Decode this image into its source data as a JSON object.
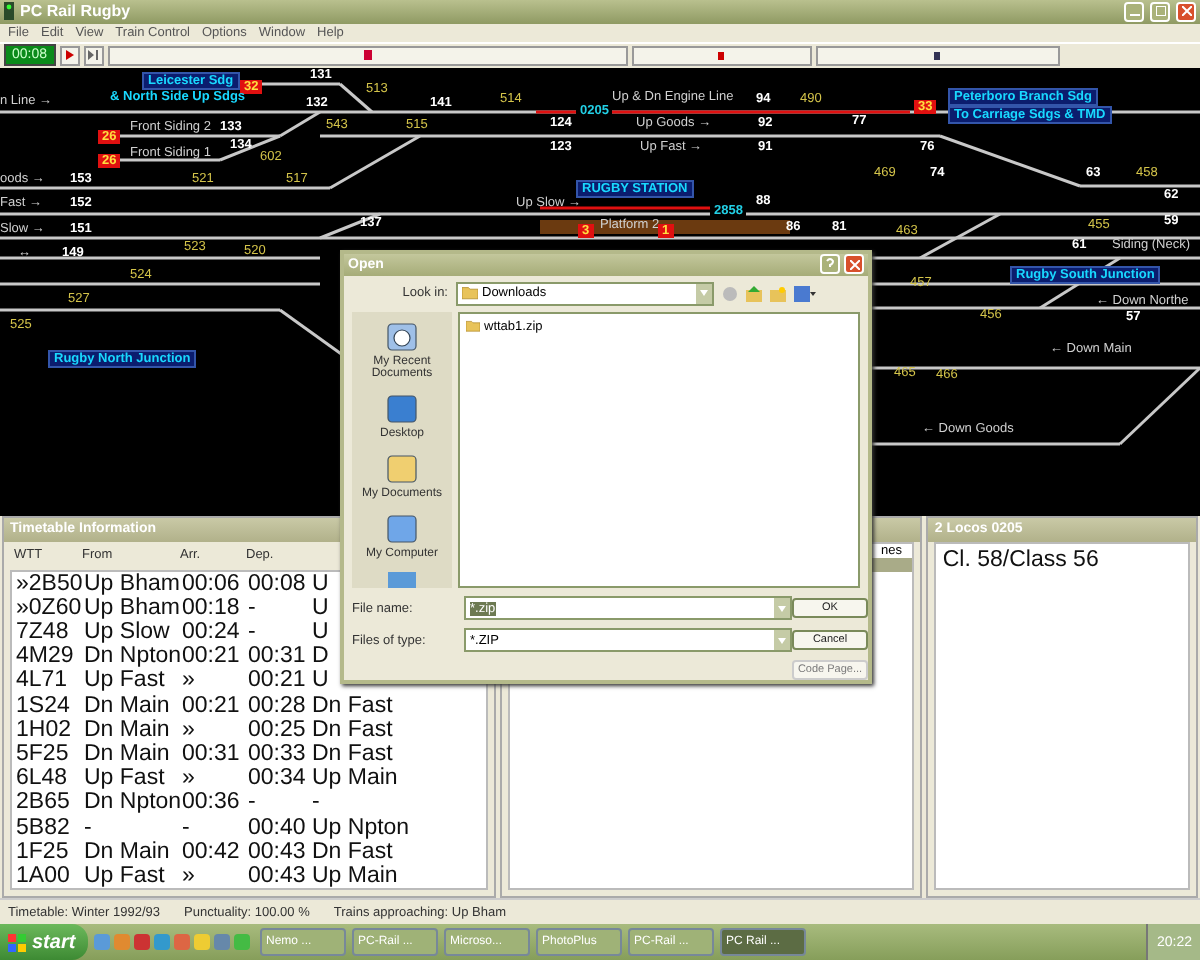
{
  "window": {
    "title": "PC Rail Rugby"
  },
  "menu": [
    "File",
    "Edit",
    "View",
    "Train Control",
    "Options",
    "Window",
    "Help"
  ],
  "toolbar": {
    "clock": "00:08"
  },
  "diagram": {
    "labels": [
      {
        "kind": "area",
        "text": "Leicester Sdg"
      },
      {
        "kind": "berth",
        "text": "32"
      },
      {
        "kind": "signal",
        "text": "131"
      },
      {
        "kind": "point",
        "text": "513"
      },
      {
        "kind": "line",
        "text": "n Line →"
      },
      {
        "kind": "location",
        "text": "& North Side Up Sdgs"
      },
      {
        "kind": "signal",
        "text": "132"
      },
      {
        "kind": "signal",
        "text": "141"
      },
      {
        "kind": "point",
        "text": "514"
      },
      {
        "kind": "line",
        "text": "Up & Dn Engine Line"
      },
      {
        "kind": "signal",
        "text": "94"
      },
      {
        "kind": "point",
        "text": "490"
      },
      {
        "kind": "area",
        "text": "Peterboro Branch Sdg"
      },
      {
        "kind": "train",
        "text": "0205"
      },
      {
        "kind": "berth",
        "text": "33"
      },
      {
        "kind": "area",
        "text": "To Carriage Sdgs & TMD"
      },
      {
        "kind": "line",
        "text": "Front Siding 2"
      },
      {
        "kind": "signal",
        "text": "133"
      },
      {
        "kind": "point",
        "text": "543"
      },
      {
        "kind": "point",
        "text": "515"
      },
      {
        "kind": "signal",
        "text": "124"
      },
      {
        "kind": "line",
        "text": "Up Goods →"
      },
      {
        "kind": "signal",
        "text": "92"
      },
      {
        "kind": "signal",
        "text": "77"
      },
      {
        "kind": "berth",
        "text": "26"
      },
      {
        "kind": "signal",
        "text": "134"
      },
      {
        "kind": "signal",
        "text": "123"
      },
      {
        "kind": "line",
        "text": "Up Fast →"
      },
      {
        "kind": "signal",
        "text": "91"
      },
      {
        "kind": "signal",
        "text": "76"
      },
      {
        "kind": "berth",
        "text": "26"
      },
      {
        "kind": "line",
        "text": "Front Siding 1"
      },
      {
        "kind": "point",
        "text": "602"
      },
      {
        "kind": "line",
        "text": "oods →"
      },
      {
        "kind": "signal",
        "text": "153"
      },
      {
        "kind": "point",
        "text": "521"
      },
      {
        "kind": "point",
        "text": "517"
      },
      {
        "kind": "point",
        "text": "469"
      },
      {
        "kind": "signal",
        "text": "74"
      },
      {
        "kind": "signal",
        "text": "63"
      },
      {
        "kind": "point",
        "text": "458"
      },
      {
        "kind": "area",
        "text": "RUGBY STATION"
      },
      {
        "kind": "signal",
        "text": "62"
      },
      {
        "kind": "line",
        "text": "Fast →"
      },
      {
        "kind": "signal",
        "text": "152"
      },
      {
        "kind": "line",
        "text": "Up Slow →"
      },
      {
        "kind": "signal",
        "text": "88"
      },
      {
        "kind": "train",
        "text": "2858"
      },
      {
        "kind": "line",
        "text": "Slow →"
      },
      {
        "kind": "signal",
        "text": "151"
      },
      {
        "kind": "signal",
        "text": "137"
      },
      {
        "kind": "berth",
        "text": "3"
      },
      {
        "kind": "line",
        "text": "Platform 2"
      },
      {
        "kind": "berth",
        "text": "1"
      },
      {
        "kind": "signal",
        "text": "86"
      },
      {
        "kind": "signal",
        "text": "81"
      },
      {
        "kind": "point",
        "text": "463"
      },
      {
        "kind": "point",
        "text": "455"
      },
      {
        "kind": "signal",
        "text": "59"
      },
      {
        "kind": "line",
        "text": "↔"
      },
      {
        "kind": "signal",
        "text": "149"
      },
      {
        "kind": "point",
        "text": "523"
      },
      {
        "kind": "point",
        "text": "520"
      },
      {
        "kind": "signal",
        "text": "61"
      },
      {
        "kind": "line",
        "text": "Siding (Neck)"
      },
      {
        "kind": "point",
        "text": "524"
      },
      {
        "kind": "point",
        "text": "457"
      },
      {
        "kind": "area",
        "text": "Rugby South Junction"
      },
      {
        "kind": "point",
        "text": "527"
      },
      {
        "kind": "line",
        "text": "← Down Northe"
      },
      {
        "kind": "point",
        "text": "525"
      },
      {
        "kind": "point",
        "text": "456"
      },
      {
        "kind": "signal",
        "text": "57"
      },
      {
        "kind": "area",
        "text": "Rugby North Junction"
      },
      {
        "kind": "line",
        "text": "← Down Main"
      },
      {
        "kind": "point",
        "text": "465"
      },
      {
        "kind": "point",
        "text": "466"
      },
      {
        "kind": "line",
        "text": "← Down Goods"
      }
    ]
  },
  "timetable": {
    "title": "Timetable Information",
    "columns": [
      "WTT",
      "From",
      "Arr.",
      "Dep."
    ],
    "rows": [
      [
        "»2B50",
        "Up Bham",
        "00:06",
        "00:08",
        "U"
      ],
      [
        "»0Z60",
        "Up Bham",
        "00:18",
        "-",
        "U"
      ],
      [
        "7Z48",
        "Up Slow",
        "00:24",
        "-",
        "U"
      ],
      [
        "4M29",
        "Dn Npton",
        "00:21",
        "00:31",
        "D"
      ],
      [
        "4L71",
        "Up Fast",
        "»",
        "00:21",
        "U"
      ],
      [
        "1S24",
        "Dn Main",
        "00:21",
        "00:28",
        "Dn Fast"
      ],
      [
        "1H02",
        "Dn Main",
        "»",
        "00:25",
        "Dn Fast"
      ],
      [
        "5F25",
        "Dn Main",
        "00:31",
        "00:33",
        "Dn Fast"
      ],
      [
        "6L48",
        "Up Fast",
        "»",
        "00:34",
        "Up Main"
      ],
      [
        "2B65",
        "Dn Npton",
        "00:36",
        "-",
        "-"
      ],
      [
        "5B82",
        "-",
        "-",
        "00:40",
        "Up Npton"
      ],
      [
        "1F25",
        "Dn Main",
        "00:42",
        "00:43",
        "Dn Fast"
      ],
      [
        "1A00",
        "Up Fast",
        "»",
        "00:43",
        "Up Main"
      ]
    ]
  },
  "middle_panel": {
    "rows": [
      {
        "text": "nes",
        "selected": false
      },
      {
        "selected": true
      }
    ]
  },
  "locos": {
    "title": "2 Locos 0205",
    "items": [
      "Cl. 58/Class 56"
    ]
  },
  "status_bar": [
    "Timetable: Winter 1992/93",
    "Punctuality: 100.00 %",
    "Trains approaching: Up Bham"
  ],
  "dialog": {
    "title": "Open",
    "look_in_label": "Look in:",
    "look_in": "Downloads",
    "places": [
      "My Recent Documents",
      "Desktop",
      "My Documents",
      "My Computer"
    ],
    "files": [
      "wttab1.zip"
    ],
    "file_name_label": "File name:",
    "file_name": "*.zip",
    "file_type_label": "Files of type:",
    "file_type": "*.ZIP",
    "buttons": [
      {
        "label": "OK",
        "disabled": false
      },
      {
        "label": "Cancel",
        "disabled": false
      },
      {
        "label": "Code Page...",
        "disabled": true
      }
    ]
  },
  "taskbar": {
    "start": "start",
    "tasks": [
      {
        "label": "Nemo ...",
        "selected": false
      },
      {
        "label": "PC-Rail ...",
        "selected": false
      },
      {
        "label": "Microso...",
        "selected": false
      },
      {
        "label": "PhotoPlus",
        "selected": false
      },
      {
        "label": "PC-Rail ...",
        "selected": false
      },
      {
        "label": "PC Rail ...",
        "selected": true
      }
    ],
    "clock": "20:22"
  }
}
